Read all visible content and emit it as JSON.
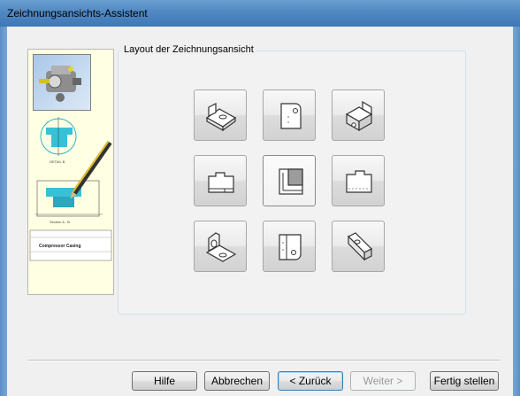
{
  "window": {
    "title": "Zeichnungsansichts-Assistent"
  },
  "sidebar": {
    "detail_label": "DETAIL B",
    "section_label": "Section A - B",
    "title_block": "Compressor Casing"
  },
  "layout_group": {
    "legend": "Layout der Zeichnungsansicht",
    "tiles": [
      {
        "name": "tile-iso-top-left",
        "icon": "iso-part-flat-icon"
      },
      {
        "name": "tile-top",
        "icon": "top-view-icon"
      },
      {
        "name": "tile-iso-top-right",
        "icon": "iso-part-corner-icon"
      },
      {
        "name": "tile-left",
        "icon": "left-view-icon"
      },
      {
        "name": "tile-front",
        "icon": "front-view-icon",
        "selected": true
      },
      {
        "name": "tile-right",
        "icon": "right-view-icon"
      },
      {
        "name": "tile-iso-bottom-left",
        "icon": "iso-part-bracket-icon"
      },
      {
        "name": "tile-bottom",
        "icon": "bottom-view-icon"
      },
      {
        "name": "tile-iso-bottom-right",
        "icon": "iso-part-bottom-icon"
      }
    ]
  },
  "buttons": {
    "help": "Hilfe",
    "cancel": "Abbrechen",
    "back": "< Zurück",
    "next": "Weiter >",
    "finish": "Fertig stellen"
  }
}
